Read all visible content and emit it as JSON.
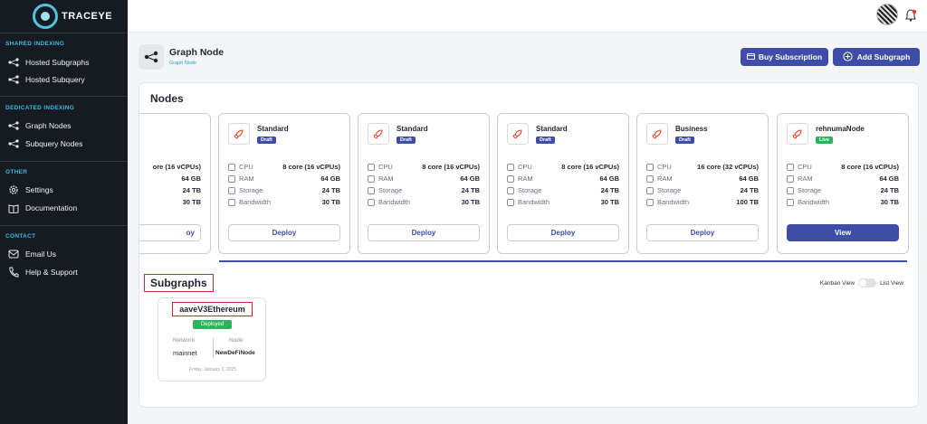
{
  "app": {
    "name": "TRACEYE"
  },
  "sidebar": {
    "sections": [
      {
        "title": "SHARED INDEXING",
        "items": [
          {
            "label": "Hosted Subgraphs",
            "icon": "graph-icon"
          },
          {
            "label": "Hosted Subquery",
            "icon": "graph-icon"
          }
        ]
      },
      {
        "title": "DEDICATED INDEXING",
        "items": [
          {
            "label": "Graph Nodes",
            "icon": "graph-icon"
          },
          {
            "label": "Subquery Nodes",
            "icon": "graph-icon"
          }
        ]
      },
      {
        "title": "OTHER",
        "items": [
          {
            "label": "Settings",
            "icon": "gear-icon"
          },
          {
            "label": "Documentation",
            "icon": "book-icon"
          }
        ]
      },
      {
        "title": "CONTACT",
        "items": [
          {
            "label": "Email Us",
            "icon": "mail-icon"
          },
          {
            "label": "Help & Support",
            "icon": "phone-icon"
          }
        ]
      }
    ]
  },
  "header": {
    "title": "Graph Node",
    "subtitle": "Graph Node",
    "buy_label": "Buy Subscription",
    "add_label": "Add Subgraph"
  },
  "nodes": {
    "title": "Nodes",
    "spec_labels": {
      "cpu": "CPU",
      "ram": "RAM",
      "storage": "Storage",
      "bandwidth": "Bandwidth"
    },
    "partial": {
      "cpu": "ore (16 vCPUs)",
      "ram": "64 GB",
      "storage": "24 TB",
      "bandwidth": "30 TB",
      "button": "oy"
    },
    "cards": [
      {
        "name": "Standard",
        "status": "Draft",
        "cpu": "8 core (16 vCPUs)",
        "ram": "64 GB",
        "storage": "24 TB",
        "bandwidth": "30 TB",
        "button": "Deploy"
      },
      {
        "name": "Standard",
        "status": "Draft",
        "cpu": "8 core (16 vCPUs)",
        "ram": "64 GB",
        "storage": "24 TB",
        "bandwidth": "30 TB",
        "button": "Deploy"
      },
      {
        "name": "Standard",
        "status": "Draft",
        "cpu": "8 core (16 vCPUs)",
        "ram": "64 GB",
        "storage": "24 TB",
        "bandwidth": "30 TB",
        "button": "Deploy"
      },
      {
        "name": "Business",
        "status": "Draft",
        "cpu": "16 core (32 vCPUs)",
        "ram": "64 GB",
        "storage": "24 TB",
        "bandwidth": "100 TB",
        "button": "Deploy"
      },
      {
        "name": "rehnumaNode",
        "status": "Live",
        "cpu": "8 core (16 vCPUs)",
        "ram": "64 GB",
        "storage": "24 TB",
        "bandwidth": "30 TB",
        "button": "View"
      }
    ]
  },
  "subgraphs": {
    "title": "Subgraphs",
    "kanban_label": "Kanban View",
    "list_label": "List View",
    "items": [
      {
        "name": "aaveV3Ethereum",
        "status": "Deployed",
        "network_label": "Network",
        "network": "mainnet",
        "node_label": "Node",
        "node": "NewDeFiNode",
        "date": "Friday, January 3, 2025"
      }
    ]
  },
  "colors": {
    "sidebar_bg": "#161b22",
    "accent": "#3e4da6",
    "cyan": "#3fb7e0",
    "draft": "#3e4da6",
    "live": "#2fb35a",
    "highlight": "#d9232e"
  }
}
